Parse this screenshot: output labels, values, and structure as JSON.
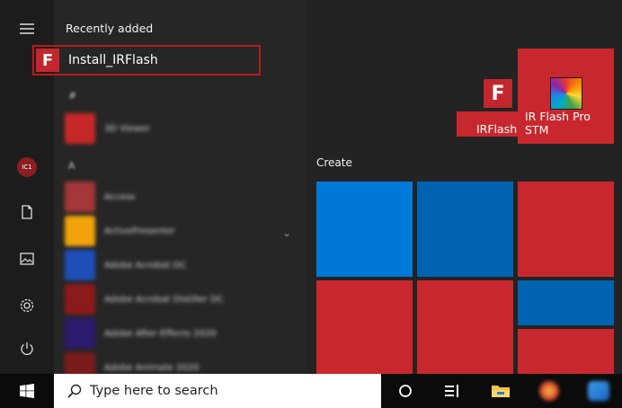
{
  "start_menu": {
    "recently_added_label": "Recently added",
    "recent_app": {
      "name": "Install_IRFlash",
      "icon_glyph": "F"
    },
    "app_list": [
      {
        "type": "letter",
        "label": "#"
      },
      {
        "type": "app",
        "name": "3D Viewer",
        "color": "#c62828"
      },
      {
        "type": "letter",
        "label": "A"
      },
      {
        "type": "app",
        "name": "Access",
        "color": "#a4373a"
      },
      {
        "type": "app",
        "name": "ActivePresenter",
        "color": "#f0a30a"
      },
      {
        "type": "app",
        "name": "Adobe Acrobat DC",
        "color": "#b71c1c"
      },
      {
        "type": "app",
        "name": "Adobe Acrobat Distiller DC",
        "color": "#8b1a1a"
      },
      {
        "type": "app",
        "name": "Adobe After Effects 2020",
        "color": "#2b1b6e"
      },
      {
        "type": "app",
        "name": "Adobe Animate 2020",
        "color": "#7a1b1b"
      }
    ]
  },
  "rail": {
    "avatar_initials": "IC1",
    "icons": [
      "document-icon",
      "pictures-icon",
      "settings-icon",
      "power-icon"
    ]
  },
  "tiles": {
    "top_tiles": [
      {
        "label": "IRFlash",
        "color": "#c8282d",
        "icon_glyph": "F"
      },
      {
        "label": "IR Flash Pro STM",
        "color": "#c8282d"
      }
    ],
    "group_title": "Create",
    "grid_colors": {
      "blue": "#0078d7",
      "dark_blue": "#0063b1",
      "red": "#c8282d"
    }
  },
  "taskbar": {
    "search_placeholder": "Type here to search",
    "icons": [
      "windows-start-icon",
      "search-icon",
      "cortana-icon",
      "task-view-icon",
      "file-explorer-icon"
    ]
  }
}
